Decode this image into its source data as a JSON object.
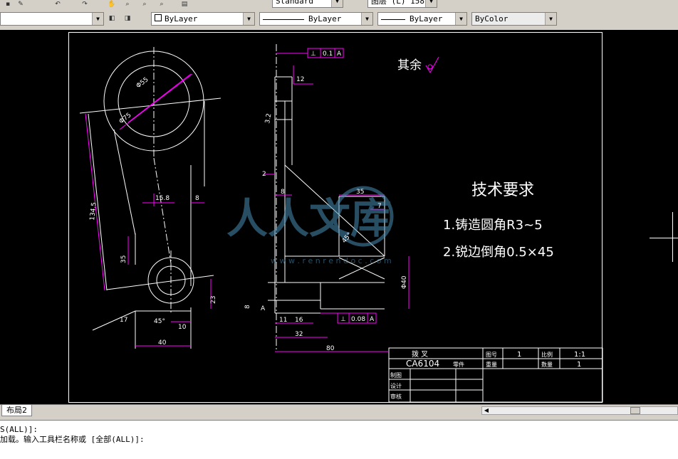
{
  "toolbar": {
    "text_style": "Standard",
    "layer_state": "图层 (L) 158"
  },
  "properties": {
    "color": "ByLayer",
    "linetype": "ByLayer",
    "lineweight": "ByLayer",
    "plotstyle": "ByColor"
  },
  "drawing": {
    "roughness_note": "其余",
    "tech_req_title": "技术要求",
    "tech_req_1": "1.铸造圆角R3~5",
    "tech_req_2": "2.锐边倒角0.5×45",
    "tol_top": "0.1",
    "tol_top_datum": "A",
    "tol_bottom": "0.08",
    "tol_bottom_datum": "A",
    "datum_label": "A",
    "dims": {
      "d1": "Φ55",
      "d2": "Φ75",
      "d3": "15.8",
      "d4": "8",
      "d5": "134.5",
      "d6": "35",
      "d7": "45°",
      "d8": "10",
      "d9": "40",
      "d10": "23",
      "d11": "17",
      "d12": "12",
      "d13": "2",
      "d14": "8",
      "d15": "35",
      "d16": "7",
      "d17": "45°",
      "d18": "Φ40",
      "d19": "11",
      "d20": "16",
      "d21": "32",
      "d22": "80",
      "d23": "8",
      "d24": "3.2"
    }
  },
  "titleblock": {
    "part_name": "拨   叉",
    "part_code": "CA6104",
    "part_code_suffix": "零件",
    "label_scale_no": "图号",
    "val_scale_no": "1",
    "label_ratio": "比例",
    "val_ratio": "1:1",
    "label_weight": "重量",
    "label_qty": "数量",
    "val_qty": "1",
    "label_draw": "制图",
    "label_design": "设计",
    "label_check": "审核"
  },
  "watermark": {
    "text": "人人文库",
    "url": "w w w . r e n r e n d o c . c o m"
  },
  "tabs": {
    "layout2": "布局2"
  },
  "command": {
    "line1": "S(ALL)]:",
    "line2": "加载。输入工具栏名称或 [全部(ALL)]:"
  },
  "colors": {
    "dim": "#ff00ff",
    "line": "#ffffff",
    "bg": "#000000",
    "watermark": "#4a8fb6"
  }
}
